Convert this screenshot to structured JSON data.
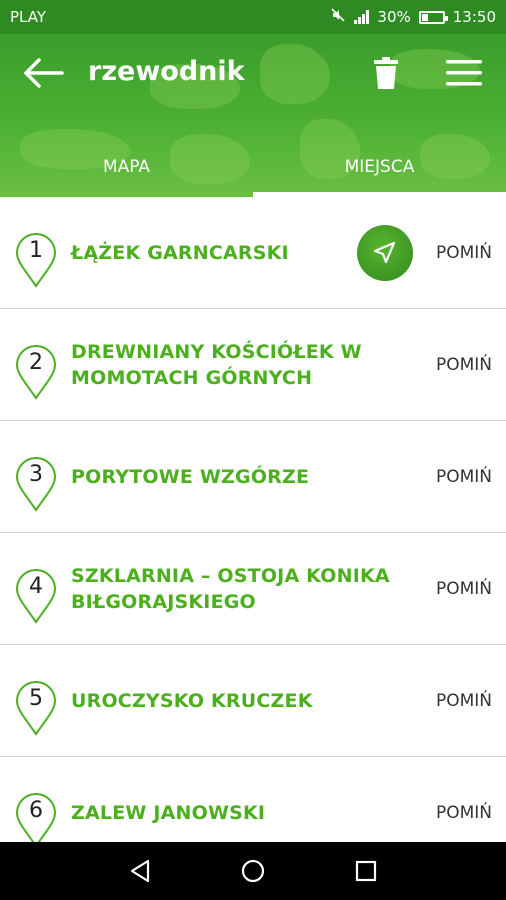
{
  "status_bar": {
    "carrier": "PLAY",
    "battery": "30%",
    "time": "13:50",
    "icons": [
      "mute-icon",
      "signal-icon",
      "battery-icon"
    ]
  },
  "header": {
    "title": "rzewodnik",
    "icons": [
      "back-arrow-icon",
      "trash-icon",
      "menu-icon"
    ]
  },
  "tabs": [
    {
      "label": "MAPA",
      "active": false
    },
    {
      "label": "MIEJSCA",
      "active": true
    }
  ],
  "places": [
    {
      "number": "1",
      "name": "ŁĄŻEK GARNCARSKI",
      "skip_label": "POMIŃ",
      "has_navigate": true
    },
    {
      "number": "2",
      "name": "DREWNIANY KOŚCIÓŁEK W MOMOTACH GÓRNYCH",
      "skip_label": "POMIŃ",
      "has_navigate": false
    },
    {
      "number": "3",
      "name": "PORYTOWE WZGÓRZE",
      "skip_label": "POMIŃ",
      "has_navigate": false
    },
    {
      "number": "4",
      "name": "SZKLARNIA – OSTOJA KONIKA BIŁGORAJSKIEGO",
      "skip_label": "POMIŃ",
      "has_navigate": false
    },
    {
      "number": "5",
      "name": "UROCZYSKO KRUCZEK",
      "skip_label": "POMIŃ",
      "has_navigate": false
    },
    {
      "number": "6",
      "name": "ZALEW JANOWSKI",
      "skip_label": "POMIŃ",
      "has_navigate": false
    }
  ],
  "nav_bar": {
    "icons": [
      "back-triangle-icon",
      "home-circle-icon",
      "recents-square-icon"
    ]
  },
  "colors": {
    "primary": "#3a9d2b",
    "accent_text": "#4caf1e",
    "fab": "#2f8a1c",
    "status_bar": "#2e8b22"
  }
}
